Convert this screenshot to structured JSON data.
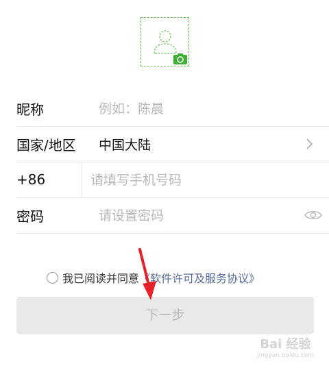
{
  "avatar": {
    "person_icon": "person-silhouette-icon",
    "camera_icon": "camera-icon"
  },
  "form": {
    "nickname": {
      "label": "昵称",
      "placeholder": "例如：陈晨"
    },
    "region": {
      "label": "国家/地区",
      "value": "中国大陆"
    },
    "phone": {
      "code": "+86",
      "placeholder": "请填写手机号码"
    },
    "password": {
      "label": "密码",
      "placeholder": "请设置密码"
    }
  },
  "agreement": {
    "prefix": "我已阅读并同意",
    "link": "《软件许可及服务协议》"
  },
  "next_button": {
    "label": "下一步"
  },
  "watermark": {
    "main": "Bai 经验",
    "sub": "jingyan.baidu.com"
  },
  "colors": {
    "accent_green": "#5fbf4a",
    "link_blue": "#576b95",
    "annotation_red": "#e8202a"
  }
}
